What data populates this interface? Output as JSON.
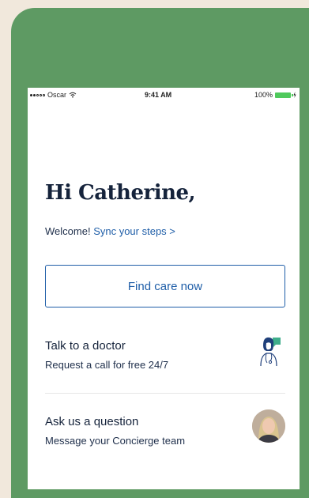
{
  "status_bar": {
    "carrier": "Oscar",
    "time": "9:41 AM",
    "battery": "100%"
  },
  "greeting": "Hi Catherine,",
  "welcome": {
    "prefix": "Welcome!",
    "link": "Sync your steps >"
  },
  "find_care_label": "Find care now",
  "rows": [
    {
      "title": "Talk to a doctor",
      "subtitle": "Request a call for free 24/7",
      "icon": "doctor-icon"
    },
    {
      "title": "Ask us a question",
      "subtitle": "Message your Concierge team",
      "icon": "avatar"
    }
  ],
  "colors": {
    "background": "#f1e8dc",
    "phone": "#5e9a63",
    "accent": "#1f5ea8",
    "heading": "#15233b",
    "chat_bubble": "#3fae8b",
    "battery": "#4fc95c"
  }
}
